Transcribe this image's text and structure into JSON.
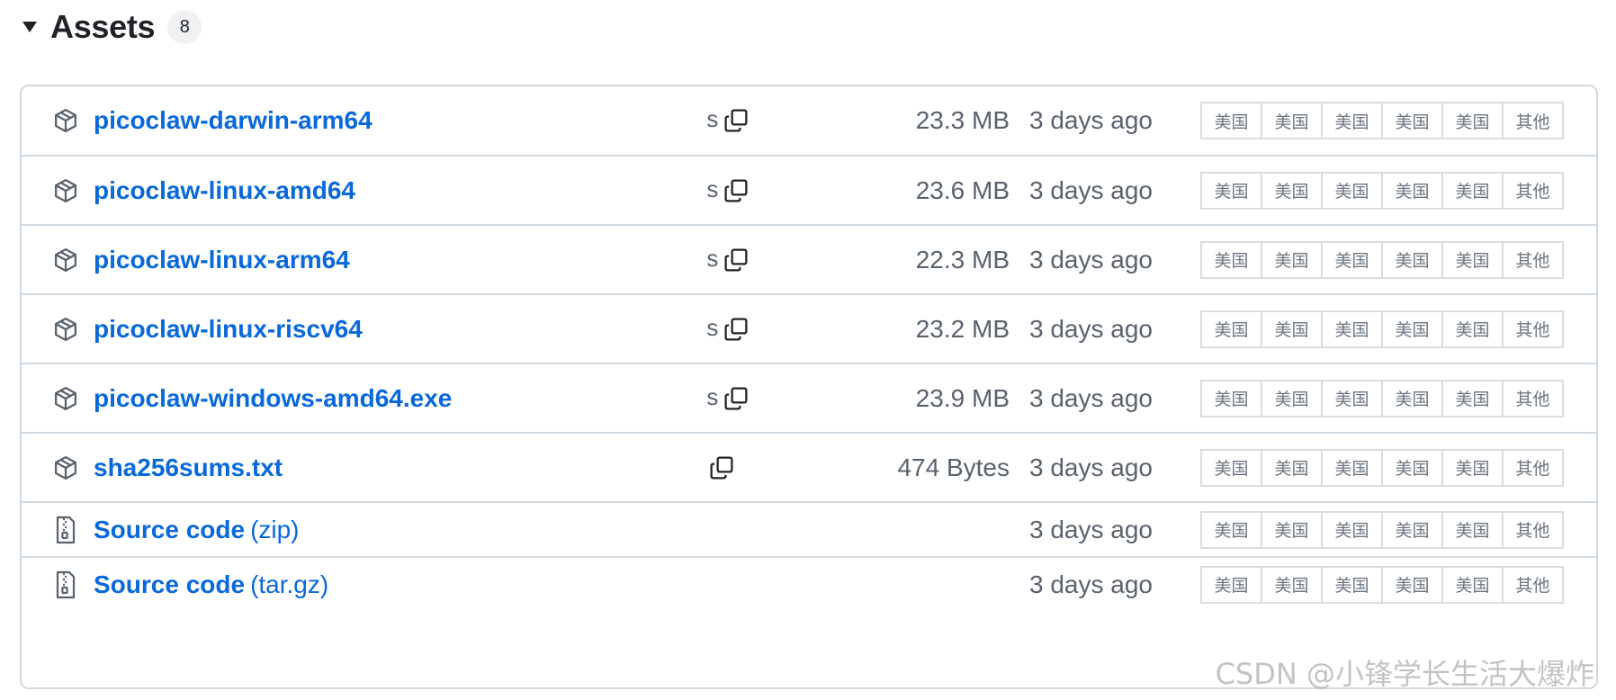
{
  "section": {
    "title": "Assets",
    "count": "8"
  },
  "assets": [
    {
      "name": "picoclaw-darwin-arm64",
      "suffix": "",
      "icon": "package-icon",
      "sha_fragment": "s",
      "has_copy": true,
      "size": "23.3 MB",
      "date": "3 days ago",
      "tags": [
        "美国",
        "美国",
        "美国",
        "美国",
        "美国",
        "其他"
      ]
    },
    {
      "name": "picoclaw-linux-amd64",
      "suffix": "",
      "icon": "package-icon",
      "sha_fragment": "s",
      "has_copy": true,
      "size": "23.6 MB",
      "date": "3 days ago",
      "tags": [
        "美国",
        "美国",
        "美国",
        "美国",
        "美国",
        "其他"
      ]
    },
    {
      "name": "picoclaw-linux-arm64",
      "suffix": "",
      "icon": "package-icon",
      "sha_fragment": "s",
      "has_copy": true,
      "size": "22.3 MB",
      "date": "3 days ago",
      "tags": [
        "美国",
        "美国",
        "美国",
        "美国",
        "美国",
        "其他"
      ]
    },
    {
      "name": "picoclaw-linux-riscv64",
      "suffix": "",
      "icon": "package-icon",
      "sha_fragment": "s",
      "has_copy": true,
      "size": "23.2 MB",
      "date": "3 days ago",
      "tags": [
        "美国",
        "美国",
        "美国",
        "美国",
        "美国",
        "其他"
      ]
    },
    {
      "name": "picoclaw-windows-amd64.exe",
      "suffix": "",
      "icon": "package-icon",
      "sha_fragment": "s",
      "has_copy": true,
      "size": "23.9 MB",
      "date": "3 days ago",
      "tags": [
        "美国",
        "美国",
        "美国",
        "美国",
        "美国",
        "其他"
      ]
    },
    {
      "name": "sha256sums.txt",
      "suffix": "",
      "icon": "package-icon",
      "sha_fragment": "",
      "has_copy": true,
      "size": "474 Bytes",
      "date": "3 days ago",
      "tags": [
        "美国",
        "美国",
        "美国",
        "美国",
        "美国",
        "其他"
      ]
    },
    {
      "name": "Source code",
      "suffix": "(zip)",
      "icon": "file-zip-icon",
      "sha_fragment": "",
      "has_copy": false,
      "size": "",
      "date": "3 days ago",
      "tags": [
        "美国",
        "美国",
        "美国",
        "美国",
        "美国",
        "其他"
      ]
    },
    {
      "name": "Source code",
      "suffix": "(tar.gz)",
      "icon": "file-zip-icon",
      "sha_fragment": "",
      "has_copy": false,
      "size": "",
      "date": "3 days ago",
      "tags": [
        "美国",
        "美国",
        "美国",
        "美国",
        "美国",
        "其他"
      ]
    }
  ],
  "watermark": "CSDN @小锋学长生活大爆炸",
  "colors": {
    "link": "#0969da",
    "muted": "#59636e",
    "border": "#d1d9e0"
  }
}
